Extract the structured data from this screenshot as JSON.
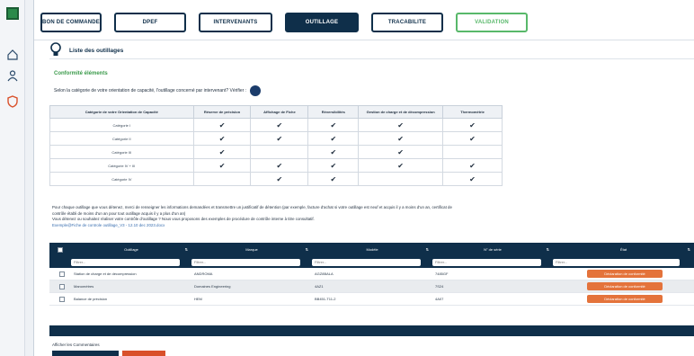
{
  "colors": {
    "navy": "#0f2f4a",
    "green": "#58b86a",
    "orange": "#e4733b",
    "red": "#d9502a"
  },
  "rail": {
    "icons": [
      "home-icon",
      "user-icon",
      "shield-icon"
    ]
  },
  "tabs": [
    {
      "label": "BON DE COMMANDE",
      "state": "normal"
    },
    {
      "label": "DPEF",
      "state": "normal"
    },
    {
      "label": "INTERVENANTS",
      "state": "normal"
    },
    {
      "label": "OUTILLAGE",
      "state": "active"
    },
    {
      "label": "TRACABILITE",
      "state": "normal"
    },
    {
      "label": "VALIDATION",
      "state": "green"
    }
  ],
  "page": {
    "title": "Liste des outillages"
  },
  "section": {
    "title": "Conformité éléments",
    "question": "Selon la catégorie de votre orientation de capacité, l'outillage concerné par intervenant? Vérifier :"
  },
  "category_table": {
    "headers": [
      "Catégorie de votre Orientation de Capacité",
      "Réserve de précision",
      "Affichage de Fiche",
      "Réversibilités",
      "Gestion de charge et de décompression",
      "Thermométrie"
    ],
    "rows": [
      {
        "label": "Catégorie I",
        "checks": [
          true,
          true,
          true,
          true,
          true
        ]
      },
      {
        "label": "Catégorie II",
        "checks": [
          true,
          true,
          true,
          true,
          true
        ]
      },
      {
        "label": "Catégorie III",
        "checks": [
          true,
          false,
          true,
          true,
          false
        ]
      },
      {
        "label": "Catégorie IV + III",
        "checks": [
          true,
          true,
          true,
          true,
          true
        ]
      },
      {
        "label": "Catégorie IV",
        "checks": [
          false,
          true,
          true,
          false,
          true
        ]
      }
    ]
  },
  "note": {
    "line1": "Pour chaque outillage que vous détenez, merci de renseigner les informations demandées et transmettre un justificatif de détention (par exemple, facture d'achat si votre outillage est neuf et acquis il y a moins d'un an, certificat de",
    "line2": "contrôle établi de moins d'un an pour tout outillage acquis il y a plus d'un an)",
    "line3": "Vous détenez ou souhaitez réaliser votre contrôle d'outillage ? Nous vous proposons des exemples de procédure de contrôle interne à titre consultatif.",
    "link": "Exemple@Fiche de controle outillage_V3 - 12.10 dec 2023.docx"
  },
  "grid": {
    "headers": [
      "Outillage",
      "Marque",
      "Modèle",
      "N° de série",
      "État"
    ],
    "filter_placeholder": "Filtrer...",
    "action_label": "Déclaration de conformité",
    "rows": [
      {
        "outillage": "Station de charge et de décompression",
        "marque": "ANDROMA",
        "modele": "AGZ8BALA",
        "serie": "7485GF",
        "alt": false
      },
      {
        "outillage": "Manomètres",
        "marque": "Domaines Engineering",
        "modele": "4AZ1",
        "serie": "7S24",
        "alt": true
      },
      {
        "outillage": "Balance de précision",
        "marque": "HEM",
        "modele": "BB451-T11-2",
        "serie": "4A07",
        "alt": false
      }
    ]
  },
  "footer": {
    "text": "Afficher les Commentaires"
  }
}
